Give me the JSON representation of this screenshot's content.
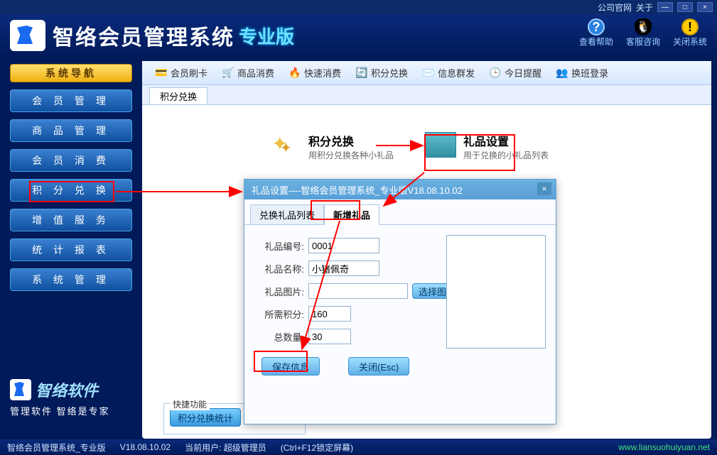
{
  "titlebar": {
    "link1": "公司官网",
    "link2": "关于"
  },
  "app": {
    "title": "智络会员管理系统",
    "edition": "专业版"
  },
  "headerActions": {
    "help": "查看帮助",
    "consult": "客服咨询",
    "close": "关闭系统"
  },
  "nav": {
    "header": "系统导航",
    "items": [
      "会 员 管 理",
      "商 品 管 理",
      "会 员 消 费",
      "积 分 兑 换",
      "增 值 服 务",
      "统 计 报 表",
      "系 统 管 理"
    ]
  },
  "brand": {
    "name": "智络软件",
    "slogan": "管理软件 智络是专家"
  },
  "toolbar": {
    "items": [
      "会员刷卡",
      "商品消费",
      "快速消费",
      "积分兑换",
      "信息群发",
      "今日提醒",
      "换班登录"
    ]
  },
  "subTab": "积分兑换",
  "features": {
    "exchange": {
      "title": "积分兑换",
      "desc": "用积分兑换各种小礼品"
    },
    "gift": {
      "title": "礼品设置",
      "desc": "用于兑换的小礼品列表"
    }
  },
  "quick": {
    "title": "快捷功能",
    "btn": "积分兑换统计"
  },
  "dialog": {
    "title": "礼品设置----智络会员管理系统_专业版V18.08.10.02",
    "tabs": [
      "兑换礼品列表",
      "新增礼品"
    ],
    "activeTab": 1,
    "form": {
      "labels": {
        "code": "礼品编号:",
        "name": "礼品名称:",
        "image": "礼品图片:",
        "points": "所需积分:",
        "qty": "总数量:"
      },
      "values": {
        "code": "0001",
        "name": "小猪佩奇",
        "image": "",
        "points": "160",
        "qty": "30"
      },
      "selectImage": "选择图片",
      "save": "保存信息",
      "close": "关闭(Esc)"
    }
  },
  "status": {
    "app": "智络会员管理系统_专业版",
    "version": "V18.08.10.02",
    "userLabel": "当前用户:",
    "user": "超级管理员",
    "hint": "(Ctrl+F12锁定屏幕)",
    "url": "www.liansuohuiyuan.net"
  }
}
